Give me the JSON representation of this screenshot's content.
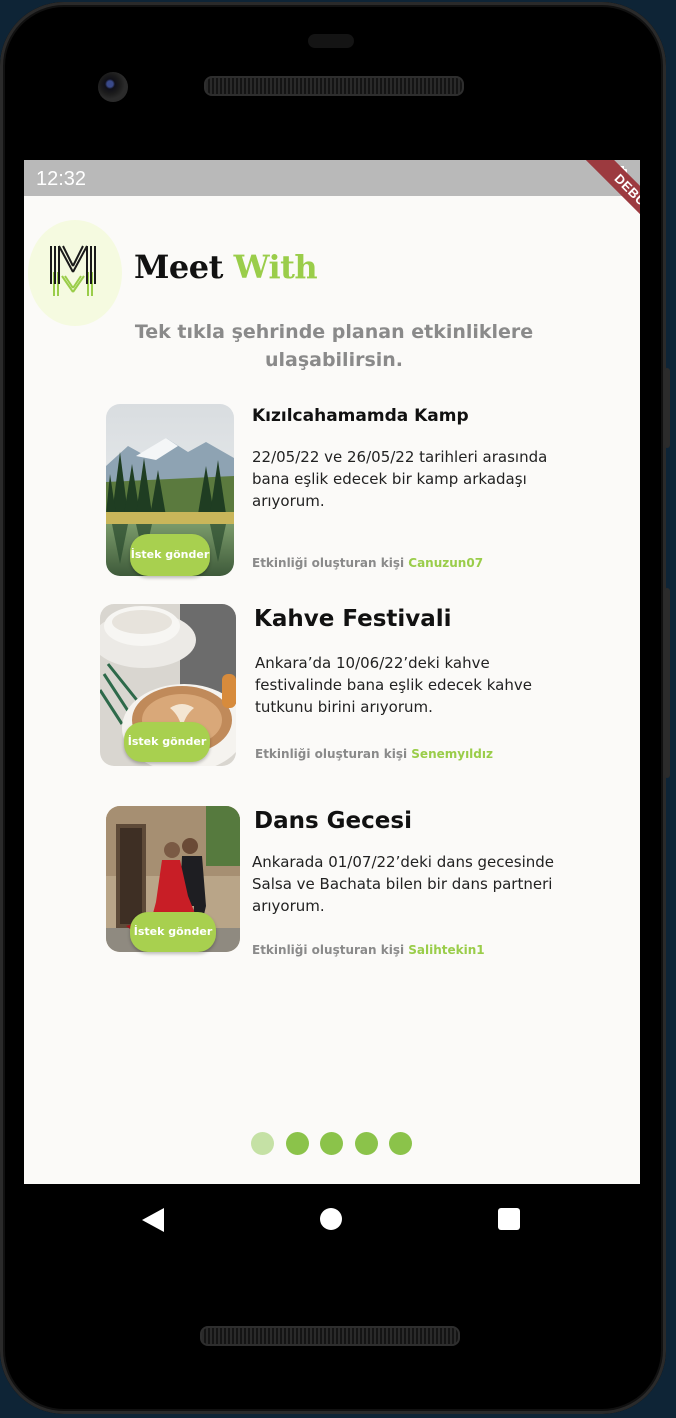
{
  "status_bar": {
    "time": "12:32",
    "debug_label": "DEBUG"
  },
  "app": {
    "brand": {
      "meet": "Meet",
      "with": "With"
    },
    "tagline": "Tek tıkla şehrinde planan etkinliklere ulaşabilirsin."
  },
  "events": [
    {
      "title": "Kızılcahamamda Kamp",
      "description": "22/05/22 ve 26/05/22 tarihleri arasında bana eşlik edecek bir kamp arkadaşı arıyorum.",
      "creator_label": "Etkinliği oluşturan kişi",
      "creator": "Canuzun07",
      "button": "İstek gönder"
    },
    {
      "title": "Kahve Festivali",
      "description": "Ankara’da 10/06/22’deki kahve festivalinde bana eşlik edecek kahve tutkunu birini arıyorum.",
      "creator_label": "Etkinliği oluşturan kişi",
      "creator": "Senemyıldız",
      "button": "İstek gönder"
    },
    {
      "title": "Dans Gecesi",
      "description": "Ankarada 01/07/22’deki dans gecesinde Salsa ve Bachata bilen bir dans partneri arıyorum.",
      "creator_label": "Etkinliği oluşturan kişi",
      "creator": "Salihtekin1",
      "button": "İstek gönder"
    }
  ],
  "pager": {
    "count": 5,
    "active_index": 0
  },
  "colors": {
    "accent": "#9acd4a",
    "dot": "#8bc34a",
    "dot_active": "#c5e1a5",
    "button": "#a8d04f"
  },
  "nav": {
    "back": "back-icon",
    "home": "home-icon",
    "recents": "recents-icon"
  }
}
